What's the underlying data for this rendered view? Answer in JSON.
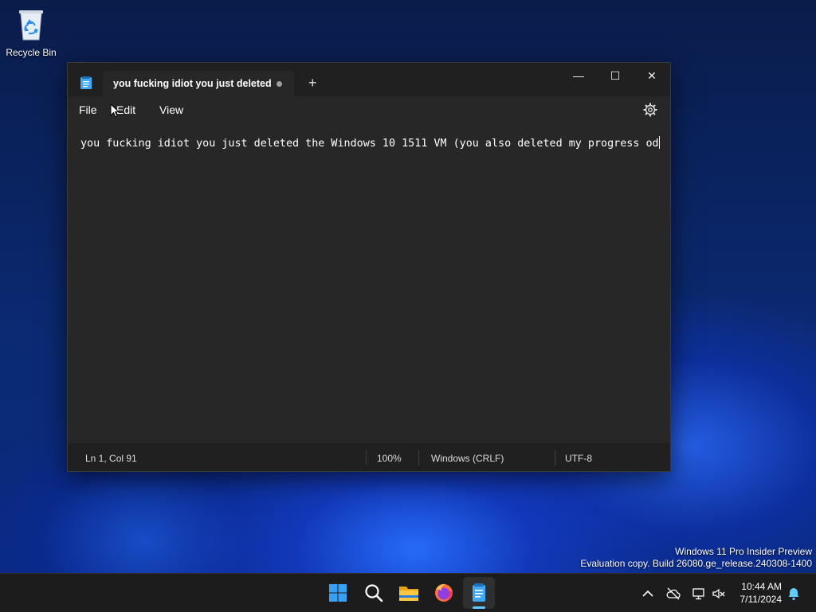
{
  "desktop": {
    "recycle_bin_label": "Recycle Bin"
  },
  "notepad": {
    "tab_title": "you fucking idiot you just deleted",
    "tab_add": "+",
    "menu": {
      "file": "File",
      "edit": "Edit",
      "view": "View"
    },
    "window_controls": {
      "minimize": "—",
      "maximize": "☐",
      "close": "✕"
    },
    "editor_text": "you fucking idiot you just deleted the Windows 10 1511 VM (you also deleted my progress od",
    "status": {
      "position": "Ln 1, Col 91",
      "zoom": "100%",
      "line_ending": "Windows (CRLF)",
      "encoding": "UTF-8"
    }
  },
  "watermark": {
    "line1": "Windows 11 Pro Insider Preview",
    "line2": "Evaluation copy. Build 26080.ge_release.240308-1400"
  },
  "taskbar": {
    "pinned": [
      "start-icon",
      "search-icon",
      "file-explorer-icon",
      "firefox-icon",
      "notepad-icon"
    ],
    "clock_time": "10:44 AM",
    "clock_date": "7/11/2024",
    "accent": "#60cdff"
  }
}
